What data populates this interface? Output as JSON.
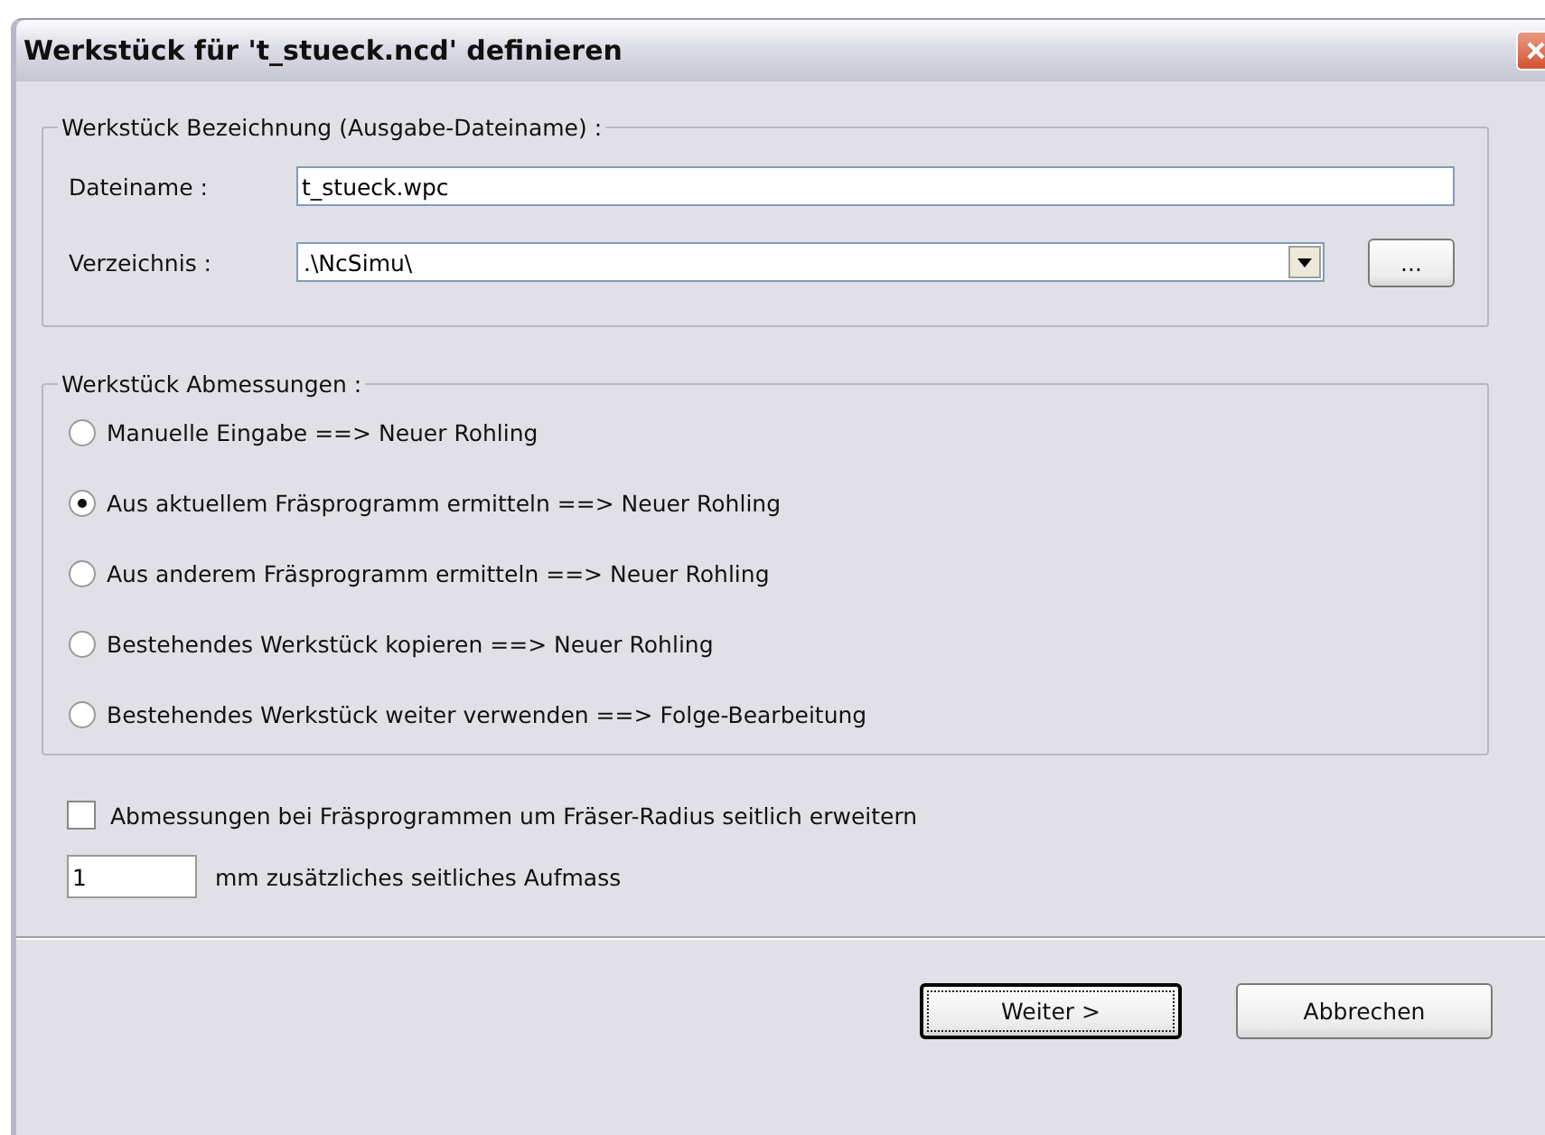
{
  "window": {
    "title": "Werkstück für 't_stueck.ncd' definieren"
  },
  "name_group": {
    "title": "Werkstück Bezeichnung (Ausgabe-Dateiname) :",
    "filename_label": "Dateiname :",
    "filename_value": "t_stueck.wpc",
    "directory_label": "Verzeichnis :",
    "directory_value": ".\\NcSimu\\",
    "browse_button": "..."
  },
  "dimensions_group": {
    "title": "Werkstück Abmessungen :",
    "options": [
      {
        "label": "Manuelle Eingabe ==> Neuer Rohling",
        "selected": false
      },
      {
        "label": "Aus aktuellem Fräsprogramm ermitteln ==> Neuer Rohling",
        "selected": true
      },
      {
        "label": "Aus anderem Fräsprogramm ermitteln ==> Neuer Rohling",
        "selected": false
      },
      {
        "label": "Bestehendes Werkstück kopieren ==> Neuer Rohling",
        "selected": false
      },
      {
        "label": "Bestehendes Werkstück weiter verwenden ==> Folge-Bearbeitung",
        "selected": false
      }
    ]
  },
  "extend_checkbox": {
    "label": "Abmessungen bei Fräsprogrammen um Fräser-Radius seitlich erweitern",
    "checked": false
  },
  "allowance": {
    "value": "1",
    "label": "mm zusätzliches seitliches Aufmass"
  },
  "buttons": [
    {
      "label": "Weiter >",
      "default": true
    },
    {
      "label": "Abbrechen",
      "default": false
    }
  ]
}
